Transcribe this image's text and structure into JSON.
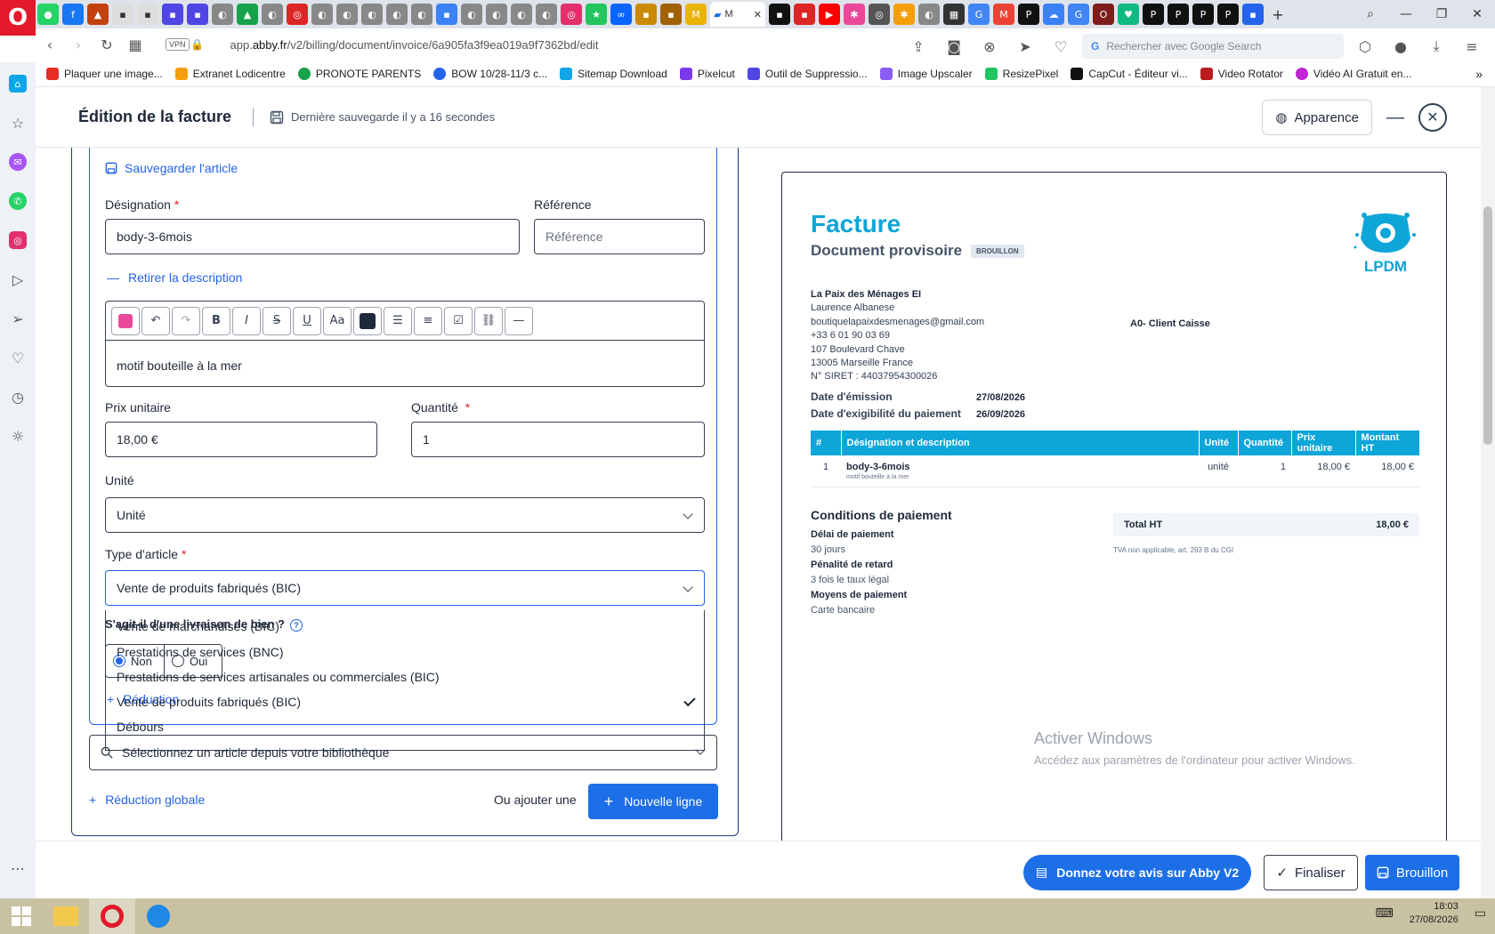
{
  "browser": {
    "active_tab_title": "M",
    "url_prefix": "app.",
    "url_domain": "abby.fr",
    "url_path": "/v2/billing/document/invoice/6a905fa3f9ea019a9f7362bd/edit",
    "vpn_label": "VPN",
    "search_placeholder": "Rechercher avec Google Search",
    "bookmarks": [
      {
        "label": "Plaquer une image...",
        "color": "#e52d27"
      },
      {
        "label": "Extranet Lodicentre",
        "color": "#f59e0b"
      },
      {
        "label": "PRONOTE PARENTS",
        "color": "#16a34a"
      },
      {
        "label": "BOW 10/28-11/3 c...",
        "color": "#2563eb"
      },
      {
        "label": "Sitemap Download",
        "color": "#0ea5e9"
      },
      {
        "label": "Pixelcut",
        "color": "#7c3aed"
      },
      {
        "label": "Outil de Suppressio...",
        "color": "#4f46e5"
      },
      {
        "label": "Image Upscaler",
        "color": "#8b5cf6"
      },
      {
        "label": "ResizePixel",
        "color": "#22c55e"
      },
      {
        "label": "CapCut - Éditeur vi...",
        "color": "#111111"
      },
      {
        "label": "Video Rotator",
        "color": "#b91c1c"
      },
      {
        "label": "Vidéo AI Gratuit en...",
        "color": "#c026d3"
      }
    ]
  },
  "header": {
    "title": "Édition de la facture",
    "save_status": "Dernière sauvegarde il y a 16 secondes",
    "apparence_label": "Apparence",
    "minimize_glyph": "—",
    "close_glyph": "✕"
  },
  "editor": {
    "save_article_label": "Sauvegarder l'article",
    "designation_label": "Désignation",
    "designation_value": "body-3-6mois",
    "reference_label": "Référence",
    "reference_placeholder": "Référence",
    "remove_description_label": "Retirer la description",
    "description_text": "motif bouteille à la mer",
    "unit_price_label": "Prix unitaire",
    "unit_price_value": "18,00 €",
    "quantity_label": "Quantité",
    "quantity_value": "1",
    "unit_label": "Unité",
    "unit_value": "Unité",
    "article_type_label": "Type d'article",
    "article_type_value": "Vente de produits fabriqués (BIC)",
    "article_type_options": [
      "Vente de marchandises (BIC)",
      "Prestations de services (BNC)",
      "Prestations de services artisanales ou commerciales (BIC)",
      "Vente de produits fabriqués (BIC)",
      "Débours"
    ],
    "delivery_question": "S'agit-il d'une livraison de bien ?",
    "radio_no": "Non",
    "radio_yes": "Oui",
    "discount_label": "Réduction",
    "library_placeholder": "Sélectionnez un article depuis votre bibliothèque",
    "global_discount_label": "Réduction globale",
    "or_add_label": "Ou ajouter une",
    "new_line_label": "Nouvelle ligne",
    "required_mark": "*"
  },
  "invoice": {
    "title": "Facture",
    "subtitle": "Document provisoire",
    "status_badge": "BROUILLON",
    "logo_text": "LPDM",
    "sender": {
      "name": "La Paix des Ménages EI",
      "contact": "Laurence Albanese",
      "email": "boutiquelapaixdesmenages@gmail.com",
      "phone": "+33 6 01 90 03 69",
      "address1": "107 Boulevard Chave",
      "address2": "13005 Marseille France",
      "siret": "N° SIRET : 44037954300026"
    },
    "client": "A0- Client Caisse",
    "issue_date_label": "Date d'émission",
    "issue_date": "27/08/2026",
    "due_date_label": "Date d'exigibilité du paiement",
    "due_date": "26/09/2026",
    "table_headers": [
      "#",
      "Désignation et description",
      "Unité",
      "Quantité",
      "Prix unitaire",
      "Montant HT"
    ],
    "line": {
      "num": "1",
      "name": "body-3-6mois",
      "desc": "motif bouteille à la mer",
      "unit": "unité",
      "qty": "1",
      "unit_price": "18,00 €",
      "amount": "18,00 €"
    },
    "conditions_title": "Conditions de paiement",
    "delay_label": "Délai de paiement",
    "delay_value": "30 jours",
    "penalty_label": "Pénalité de retard",
    "penalty_value": "3 fois le taux légal",
    "payment_label": "Moyens de paiement",
    "payment_value": "Carte bancaire",
    "total_label": "Total HT",
    "total_value": "18,00 €",
    "tva_note": "TVA non applicable, art. 293 B du CGI"
  },
  "watermark": {
    "line1": "Activer Windows",
    "line2": "Accédez aux paramètres de l'ordinateur pour activer Windows."
  },
  "footer": {
    "feedback_label": "Donnez votre avis sur Abby V2",
    "finalize_label": "Finaliser",
    "draft_label": "Brouillon"
  },
  "taskbar": {
    "time": "18:03",
    "date": "27/08/2026"
  },
  "colors": {
    "brand_blue": "#1d6fe8",
    "invoice_cyan": "#0ea5d8"
  }
}
